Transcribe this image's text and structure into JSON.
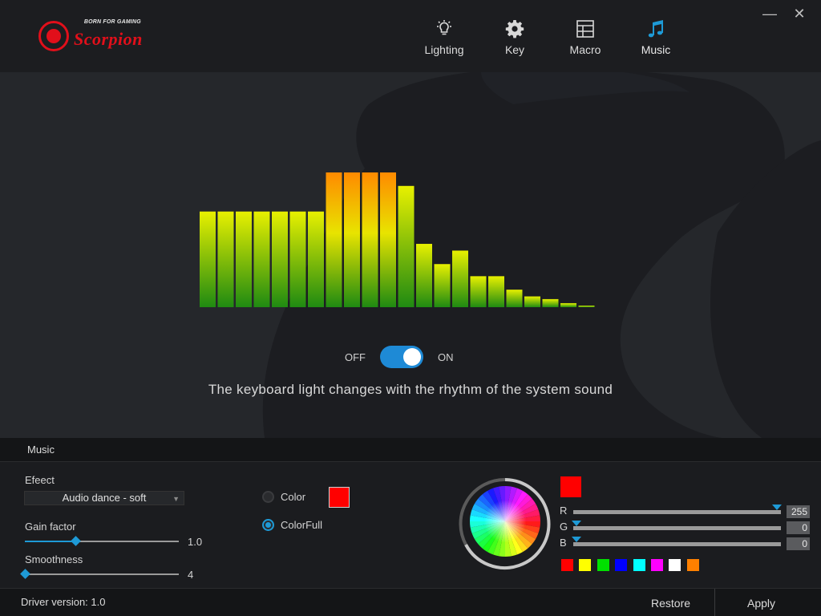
{
  "app": {
    "brand_tag": "BORN FOR GAMING",
    "brand_name": "Scorpion"
  },
  "nav": {
    "items": [
      {
        "label": "Lighting",
        "icon": "lightbulb-icon",
        "active": false
      },
      {
        "label": "Key",
        "icon": "gear-icon",
        "active": false
      },
      {
        "label": "Macro",
        "icon": "grid-icon",
        "active": false
      },
      {
        "label": "Music",
        "icon": "music-note-icon",
        "active": true
      }
    ]
  },
  "window": {
    "minimize": "—",
    "close": "✕"
  },
  "visualizer": {
    "bar_levels": [
      0.71,
      0.71,
      0.71,
      0.71,
      0.71,
      0.71,
      0.71,
      1.0,
      1.0,
      1.0,
      1.0,
      0.9,
      0.47,
      0.32,
      0.42,
      0.23,
      0.23,
      0.13,
      0.08,
      0.06,
      0.03,
      0.01
    ],
    "colors": {
      "top_low": "#e8f000",
      "top_high": "#ff8a00",
      "bottom": "#1f8a12"
    }
  },
  "toggle": {
    "off_label": "OFF",
    "on_label": "ON",
    "state": "on"
  },
  "description": "The keyboard light changes with the rhythm of the system sound",
  "section": {
    "title": "Music"
  },
  "settings": {
    "effect_label": "Efeect",
    "effect_value": "Audio dance - soft",
    "gain_label": "Gain factor",
    "gain_value": "1.0",
    "gain_level": 0.33,
    "smooth_label": "Smoothness",
    "smooth_value": "4",
    "smooth_level": 0.0,
    "color_mode_options": [
      "Color",
      "ColorFull"
    ],
    "color_mode_selected": "ColorFull",
    "color_chip": "#ff0000"
  },
  "picker": {
    "preview_color": "#ff0000",
    "r_label": "R",
    "g_label": "G",
    "b_label": "B",
    "r_value": "255",
    "g_value": "0",
    "b_value": "0",
    "swatches": [
      "#ff0000",
      "#ffff00",
      "#00e000",
      "#0000ff",
      "#00ffff",
      "#ff00ff",
      "#ffffff",
      "#ff8000"
    ]
  },
  "footer": {
    "driver": "Driver version: 1.0",
    "restore": "Restore",
    "apply": "Apply"
  }
}
